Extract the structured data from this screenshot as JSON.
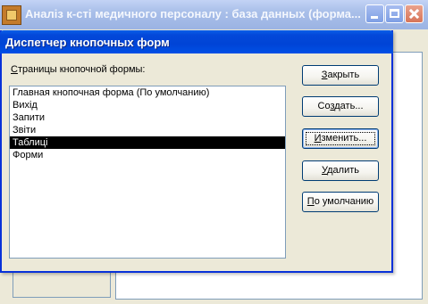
{
  "background_window": {
    "title": "Аналіз к-сті медичного персоналу : база данных (форма..."
  },
  "dialog": {
    "title": "Диспетчер кнопочных форм",
    "list_label": {
      "accel": "С",
      "rest": "траницы кнопочной формы:"
    },
    "pages": [
      "Главная кнопочная форма (По умолчанию)",
      "Вихід",
      "Запити",
      "Звіти",
      "Таблиці",
      "Форми"
    ],
    "selected_index": 4,
    "buttons": {
      "close": {
        "accel": "З",
        "rest": "акрыть"
      },
      "create": {
        "pre": "Со",
        "accel": "з",
        "rest": "дать..."
      },
      "edit": {
        "pre": "",
        "accel": "И",
        "rest": "зменить..."
      },
      "delete": {
        "pre": "",
        "accel": "У",
        "rest": "далить"
      },
      "default": {
        "pre": "",
        "accel": "П",
        "rest": "о умолчанию"
      }
    }
  },
  "colors": {
    "dialog_title_bg": "#0044d6",
    "selected_bg": "#000000",
    "selected_text": "#ffffff",
    "list_border": "#7f9db9"
  }
}
